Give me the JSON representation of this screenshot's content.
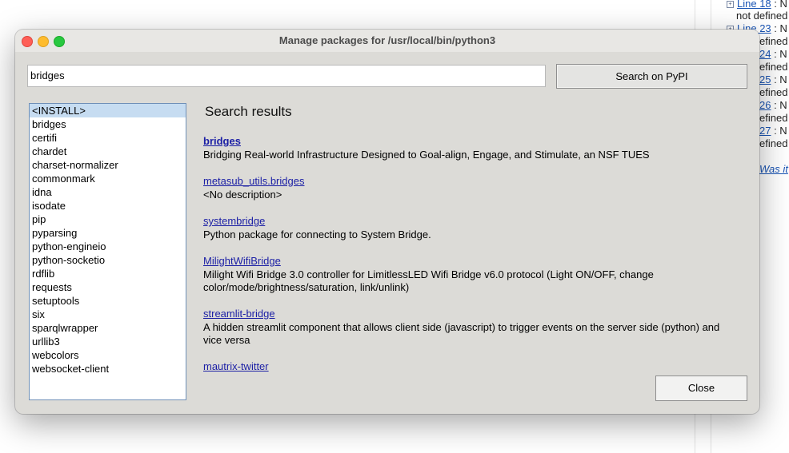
{
  "background": {
    "lines": [
      {
        "link": "Line 18",
        "text": " : N"
      },
      {
        "link": "",
        "text": "not defined"
      },
      {
        "link": "Line 23",
        "text": " : N"
      },
      {
        "link": "",
        "text": "efined"
      },
      {
        "link": "24",
        "text": " : N"
      },
      {
        "link": "",
        "text": "efined"
      },
      {
        "link": "25",
        "text": " : N"
      },
      {
        "link": "",
        "text": "efined"
      },
      {
        "link": "26",
        "text": " : N"
      },
      {
        "link": "",
        "text": "efined"
      },
      {
        "link": "27",
        "text": " : N"
      },
      {
        "link": "",
        "text": "efined"
      }
    ],
    "italic_link": "Was it"
  },
  "dialog": {
    "title": "Manage packages for /usr/local/bin/python3",
    "search": {
      "value": "bridges",
      "button_label": "Search on PyPI"
    },
    "packages": [
      "<INSTALL>",
      "bridges",
      "certifi",
      "chardet",
      "charset-normalizer",
      "commonmark",
      "idna",
      "isodate",
      "pip",
      "pyparsing",
      "python-engineio",
      "python-socketio",
      "rdflib",
      "requests",
      "setuptools",
      "six",
      "sparqlwrapper",
      "urllib3",
      "webcolors",
      "websocket-client"
    ],
    "selected_package": "<INSTALL>",
    "results_title": "Search results",
    "results": [
      {
        "name": "bridges",
        "description": "Bridging Real-world Infrastructure Designed to Goal-align, Engage, and Stimulate, an NSF TUES"
      },
      {
        "name": "metasub_utils.bridges",
        "description": "<No description>"
      },
      {
        "name": "systembridge",
        "description": "Python package for connecting to System Bridge."
      },
      {
        "name": "MilightWifiBridge",
        "description": "Milight Wifi Bridge 3.0 controller for LimitlessLED Wifi Bridge v6.0 protocol (Light ON/OFF, change color/mode/brightness/saturation, link/unlink)"
      },
      {
        "name": "streamlit-bridge",
        "description": "A hidden streamlit component that allows client side (javascript) to trigger events on the server side (python) and vice versa"
      },
      {
        "name": "mautrix-twitter",
        "description": ""
      }
    ],
    "close_label": "Close"
  }
}
